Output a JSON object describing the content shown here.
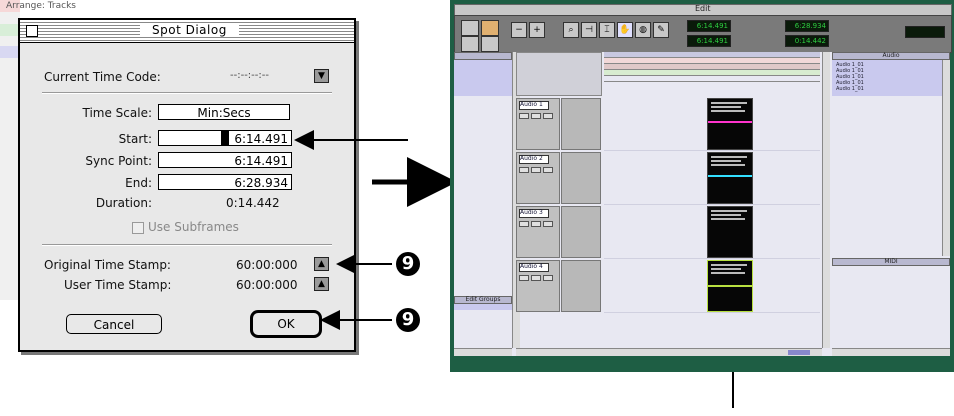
{
  "background_window": {
    "title": "Arrange: Tracks"
  },
  "spot_dialog": {
    "title": "Spot Dialog",
    "current_time_code_label": "Current Time Code:",
    "current_time_code_value": "--:--:--:--",
    "time_scale_label": "Time Scale:",
    "time_scale_value": "Min:Secs",
    "start_label": "Start:",
    "start_value": "6:14.491",
    "sync_point_label": "Sync Point:",
    "sync_point_value": "6:14.491",
    "end_label": "End:",
    "end_value": "6:28.934",
    "duration_label": "Duration:",
    "duration_value": "0:14.442",
    "use_subframes_label": "Use Subframes",
    "original_time_stamp_label": "Original Time Stamp:",
    "original_time_stamp_value": "60:00:000",
    "user_time_stamp_label": "User Time Stamp:",
    "user_time_stamp_value": "60:00:000",
    "cancel_label": "Cancel",
    "ok_label": "OK"
  },
  "pro_tools_window": {
    "title": "Edit",
    "track_names": [
      "Audio 1",
      "Audio 2",
      "Audio 3",
      "Audio 4"
    ],
    "groups_header": "Edit Groups",
    "regions_header": "Audio",
    "region_list_items": [
      "Audio 1_01",
      "Audio 1_01",
      "Audio 1_01",
      "Audio 1_01",
      "Audio 1_01"
    ],
    "lower_pane_header": "MIDI",
    "counter_main": "6:14.491",
    "counter_start": "6:14.491",
    "counter_end": "6:28.934",
    "counter_length": "0:14.442"
  },
  "callouts": {
    "step_a": "9",
    "step_b": "9"
  },
  "colors": {
    "window_green": "#1e5e44",
    "region_black": "#060606",
    "highlight_magenta": "#ff33cc",
    "highlight_cyan": "#33e0ff",
    "highlight_green": "#b8e040",
    "lilac": "#c9c9ee"
  }
}
